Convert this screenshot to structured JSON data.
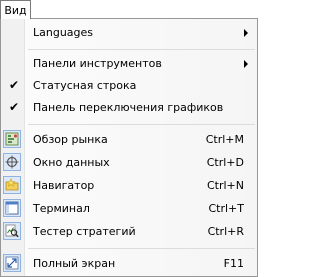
{
  "menubar": {
    "label": "Вид"
  },
  "menu": {
    "languages": "Languages",
    "toolbars": "Панели инструментов",
    "status_bar": "Статусная строка",
    "chart_tabs": "Панель переключения графиков",
    "market_watch": {
      "label": "Обзор рынка",
      "shortcut": "Ctrl+M"
    },
    "data_window": {
      "label": "Окно данных",
      "shortcut": "Ctrl+D"
    },
    "navigator": {
      "label": "Навигатор",
      "shortcut": "Ctrl+N"
    },
    "terminal": {
      "label": "Терминал",
      "shortcut": "Ctrl+T"
    },
    "strategy_tester": {
      "label": "Тестер стратегий",
      "shortcut": "Ctrl+R"
    },
    "full_screen": {
      "label": "Полный экран",
      "shortcut": "F11"
    }
  },
  "icons": {
    "check": "✔",
    "submenu_arrow": "triangle-right",
    "market_watch": "market-watch-icon",
    "data_window": "crosshair-icon",
    "navigator": "folder-star-icon",
    "terminal": "terminal-window-icon",
    "strategy_tester": "magnifier-chart-icon",
    "full_screen": "expand-icon"
  },
  "colors": {
    "icon_frame": "#8fb2de",
    "icon_bg": "#dde9f8",
    "separator": "#dcdcdc"
  }
}
